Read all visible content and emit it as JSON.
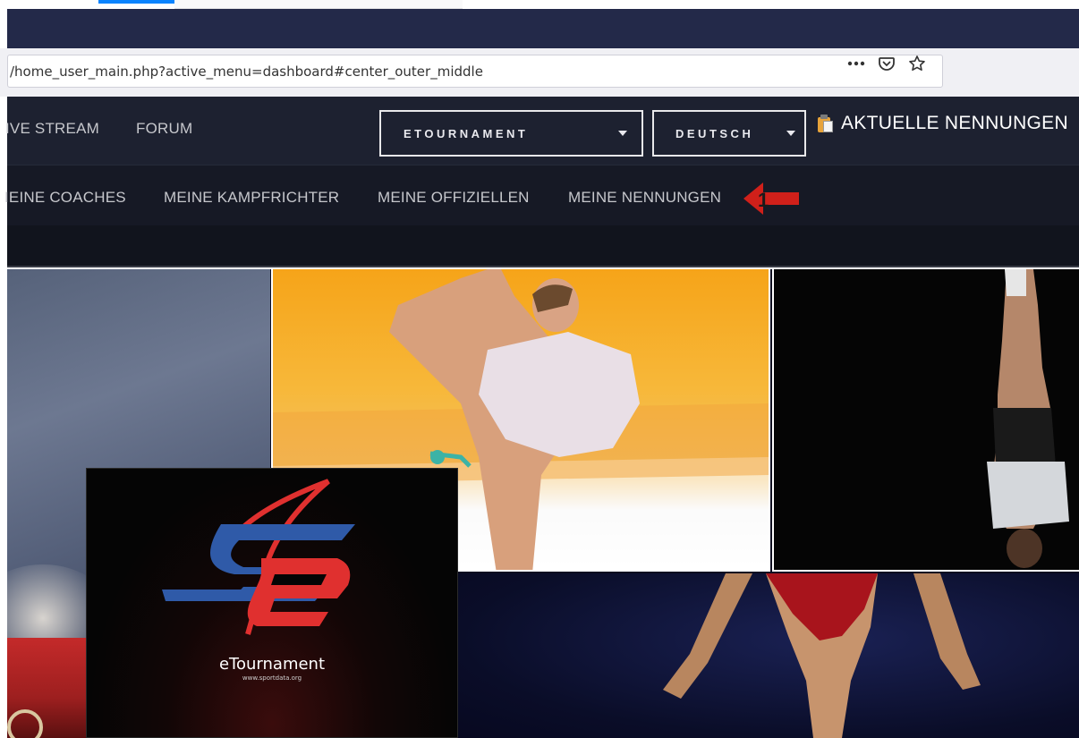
{
  "browser": {
    "url": "/home_user_main.php?active_menu=dashboard#center_outer_middle",
    "icons": [
      "more-icon",
      "pocket-icon",
      "bookmark-star-icon"
    ]
  },
  "nav_top": {
    "links": [
      "IVE STREAM",
      "FORUM"
    ],
    "dropdown_event": "ETOURNAMENT",
    "dropdown_language": "DEUTSCH",
    "aktuelle_nennungen": "AKTUELLE NENNUNGEN"
  },
  "nav_sub": {
    "links": [
      "IEINE COACHES",
      "MEINE KAMPFRICHTER",
      "MEINE OFFIZIELLEN",
      "MEINE NENNUNGEN"
    ]
  },
  "annotation": {
    "number": "1",
    "color": "#d0201a"
  },
  "hero": {
    "logo_title": "eTournament",
    "logo_url": "www.sportdata.org"
  },
  "colors": {
    "browser_dark": "#232949",
    "nav_bg": "#1d2130",
    "subnav_bg": "#161925",
    "logo_blue": "#2f5aa8",
    "logo_red": "#e0302f"
  }
}
